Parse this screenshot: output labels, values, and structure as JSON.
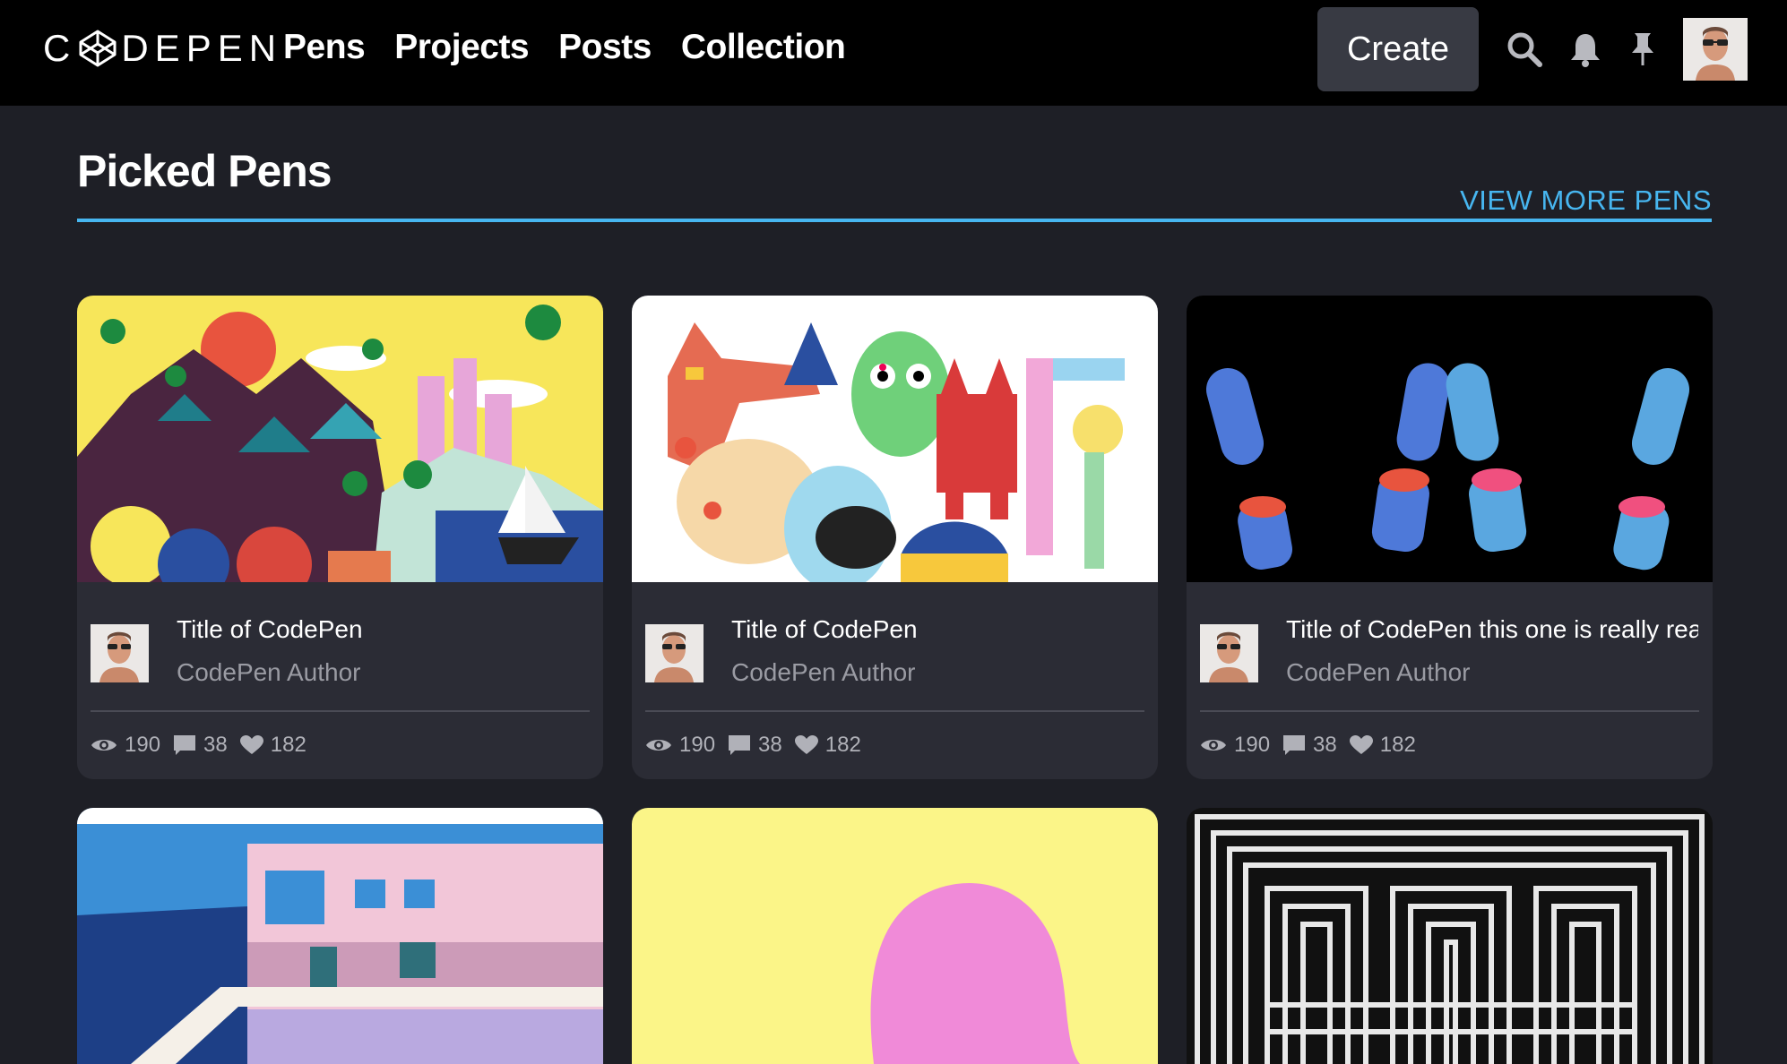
{
  "nav": {
    "logo_text": "CODEPEN",
    "links": [
      "Pens",
      "Projects",
      "Posts",
      "Collection"
    ],
    "create_label": "Create",
    "icons": [
      "search-icon",
      "bell-icon",
      "pin-icon"
    ]
  },
  "section": {
    "title": "Picked Pens",
    "view_more": "VIEW MORE PENS",
    "accent": "#47b6f0"
  },
  "cards": [
    {
      "title": "Title of CodePen",
      "author": "CodePen Author",
      "views": "190",
      "comments": "38",
      "likes": "182"
    },
    {
      "title": "Title of CodePen",
      "author": "CodePen Author",
      "views": "190",
      "comments": "38",
      "likes": "182"
    },
    {
      "title": "Title of CodePen this one is really really",
      "author": "CodePen Author",
      "views": "190",
      "comments": "38",
      "likes": "182"
    }
  ],
  "colors": {
    "background": "#1e1f26",
    "card": "#2b2c35",
    "nav": "#000000",
    "create_button": "#383a43"
  }
}
